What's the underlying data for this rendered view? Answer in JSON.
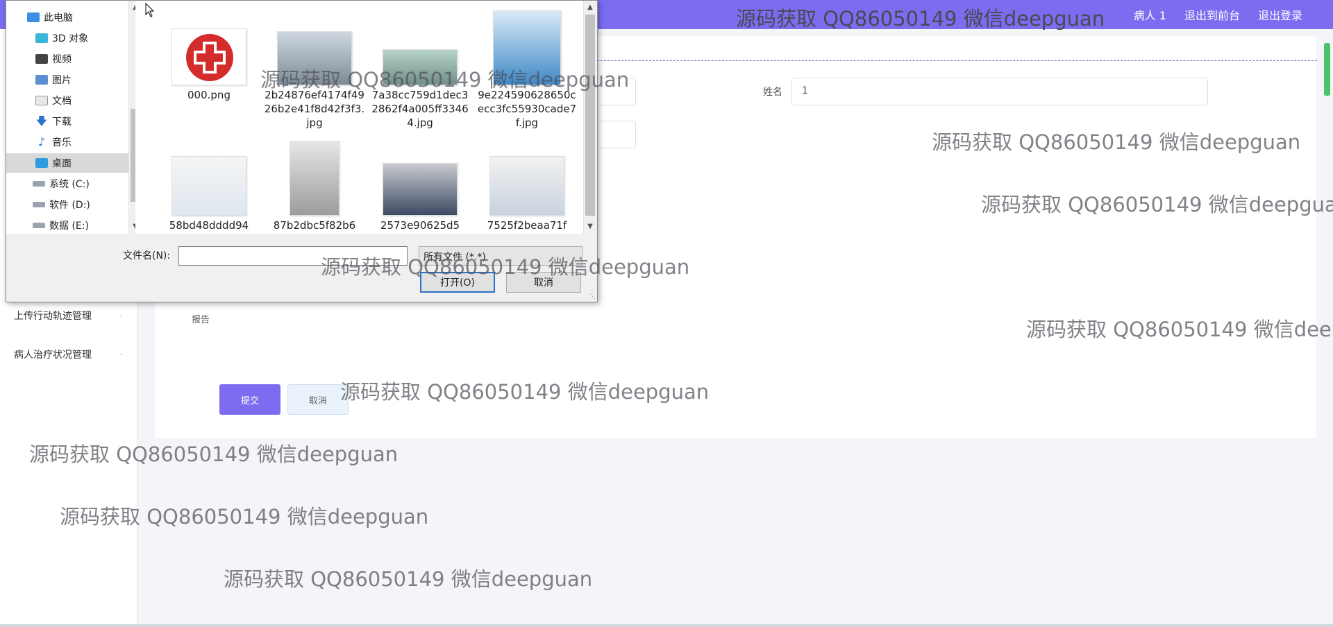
{
  "header": {
    "brand_watermark": "源码获取 QQ86050149 微信deepguan",
    "nav": [
      "病人 1",
      "退出到前台",
      "退出登录"
    ]
  },
  "sidebar": {
    "items": [
      "上传行动轨迹管理",
      "病人治疗状况管理"
    ]
  },
  "form": {
    "name_label": "姓名",
    "name_value": "1",
    "report_label": "报告",
    "submit_label": "提交",
    "cancel_label": "取消"
  },
  "dialog": {
    "nav_items": [
      "此电脑",
      "3D 对象",
      "视频",
      "图片",
      "文档",
      "下载",
      "音乐",
      "桌面",
      "系统 (C:)",
      "软件 (D:)",
      "数据 (E:)"
    ],
    "selected_nav": "桌面",
    "files": [
      {
        "name": "000.png",
        "icon": "red-cross-logo"
      },
      {
        "name": "2b24876ef4174f4926b2e41f8d42f3f3.jpg",
        "icon": "hospital-lobby-photo"
      },
      {
        "name": "7a38cc759d1dec32862f4a005ff33464.jpg",
        "icon": "hospital-ward-photo"
      },
      {
        "name": "9e224590628650cecc3fc55930cade7f.jpg",
        "icon": "hospital-sign-photo"
      },
      {
        "name": "58bd48dddd94",
        "icon": "female-doctor-photo"
      },
      {
        "name": "87b2dbc5f82b6",
        "icon": "female-doctor-portrait"
      },
      {
        "name": "2573e90625d5",
        "icon": "waiting-room-photo"
      },
      {
        "name": "7525f2beaa71f",
        "icon": "male-doctor-photo"
      }
    ],
    "filename_label": "文件名(N):",
    "filename_value": "",
    "filter_value": "所有文件 (*.*)",
    "open_label": "打开(O)",
    "cancel_label": "取消"
  },
  "watermark": "源码获取 QQ86050149 微信deepguan",
  "colors": {
    "accent": "#7b6cf0",
    "dialog_bg": "#f0f0f0",
    "selected_nav": "#d9d9d9"
  }
}
